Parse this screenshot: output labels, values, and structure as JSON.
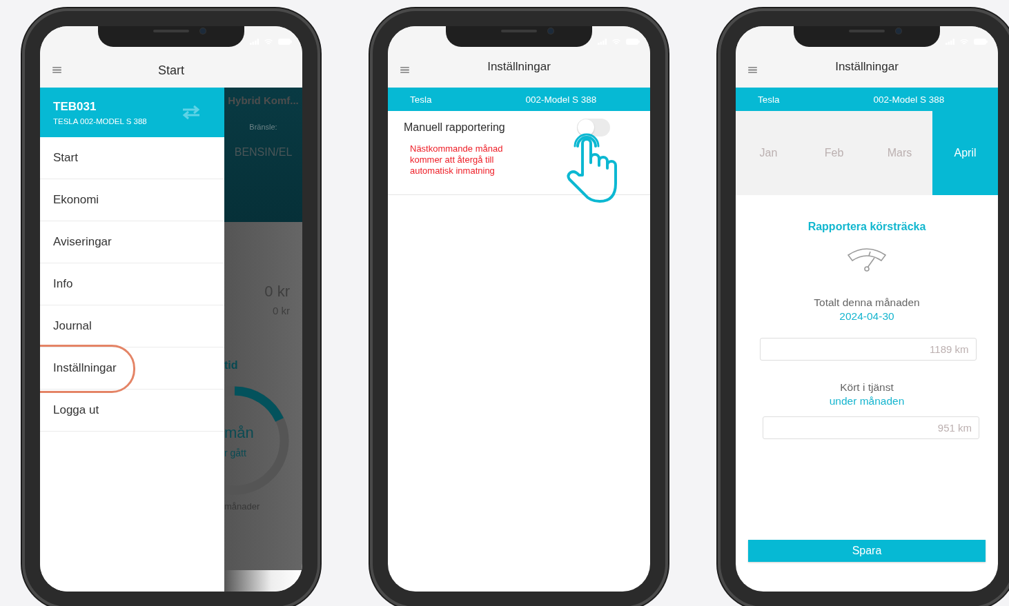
{
  "menu_screen": {
    "title": "Start",
    "drawer": {
      "code": "TEB031",
      "vehicle": "TESLA 002-MODEL S 388",
      "items": [
        {
          "label": "Start",
          "highlighted": false
        },
        {
          "label": "Ekonomi",
          "highlighted": false
        },
        {
          "label": "Aviseringar",
          "highlighted": false
        },
        {
          "label": "Info",
          "highlighted": false
        },
        {
          "label": "Journal",
          "highlighted": false
        },
        {
          "label": "Inställningar",
          "highlighted": true
        },
        {
          "label": "Logga ut",
          "highlighted": false
        }
      ]
    },
    "background": {
      "title": "Hybrid Komf...",
      "fuel_label": "Bränsle:",
      "fuel": "BENSIN/EL",
      "amount": "0 kr",
      "amount_small": "0 kr",
      "section": "tid",
      "center_value": "mån",
      "center_caption": "r gått",
      "footer": "månader"
    }
  },
  "settings_screen": {
    "title": "Inställningar",
    "make": "Tesla",
    "model": "002-Model S 388",
    "setting": {
      "label": "Manuell rapportering",
      "on": false,
      "note": "Nästkommande månad kommer att återgå till automatisk inmatning"
    }
  },
  "report_screen": {
    "title": "Inställningar",
    "make": "Tesla",
    "model": "002-Model S 388",
    "months": [
      {
        "label": "Jan",
        "selected": false
      },
      {
        "label": "Feb",
        "selected": false
      },
      {
        "label": "Mars",
        "selected": false
      },
      {
        "label": "April",
        "selected": true
      }
    ],
    "heading": "Rapportera körsträcka",
    "total_label": "Totalt denna månaden",
    "total_date": "2024-04-30",
    "total_value": "1189 km",
    "service_label": "Kört i tjänst",
    "service_caption": "under månaden",
    "service_value": "951 km",
    "save_button": "Spara"
  }
}
